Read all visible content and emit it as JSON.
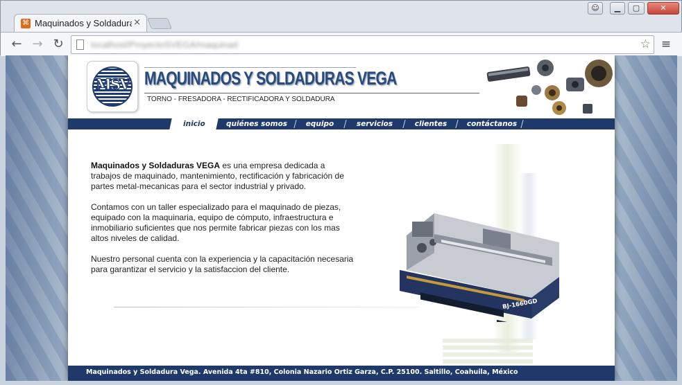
{
  "browser": {
    "tab_title": "Maquinados y Soldadura",
    "tab_close": "×",
    "url": "localhost/ProyectoSVEGA/maquinad",
    "favicon": "xampp-icon",
    "icons": {
      "back": "back-arrow-icon",
      "forward": "forward-arrow-icon",
      "reload": "reload-icon",
      "star": "star-icon",
      "menu": "hamburger-menu-icon"
    }
  },
  "header": {
    "logo_text": "MSV",
    "company_name": "MAQUINADOS Y SOLDADURAS VEGA",
    "tagline": "TORNO - FRESADORA - RECTIFICADORA Y SOLDADURA"
  },
  "nav": {
    "items": [
      {
        "label": "inicio",
        "active": true
      },
      {
        "label": "quiénes somos",
        "active": false
      },
      {
        "label": "equipo",
        "active": false
      },
      {
        "label": "servicios",
        "active": false
      },
      {
        "label": "clientes",
        "active": false
      },
      {
        "label": "contáctanos",
        "active": false
      }
    ]
  },
  "content": {
    "p1_bold": "Maquinados y Soldaduras VEGA",
    "p1_rest": " es una empresa dedicada a trabajos de maquinado, mantenimiento, rectificación y fabricación de partes metal-mecanicas para el sector industrial y privado.",
    "p2": "Contamos con un taller especializado para el maquinado de piezas, equipado con la maquinaria, equipo de cómputo, infraestructura e inmobiliario suficientes que nos permite fabricar piezas con los mas altos niveles de calidad.",
    "p3": "Nuestro personal cuenta con la experiencia y la capacitación necesaria para garantizar el servicio y la satisfaccion del cliente.",
    "machine_label": "BJ-1660GD"
  },
  "footer": {
    "text": "Maquinados y Soldadura Vega. Avenida 4ta #810, Colonia Nazario Ortiz Garza, C.P. 25100. Saltillo, Coahuila, México"
  },
  "colors": {
    "brand_navy": "#1f3a6a",
    "page_stripes": "#9db0c7"
  }
}
